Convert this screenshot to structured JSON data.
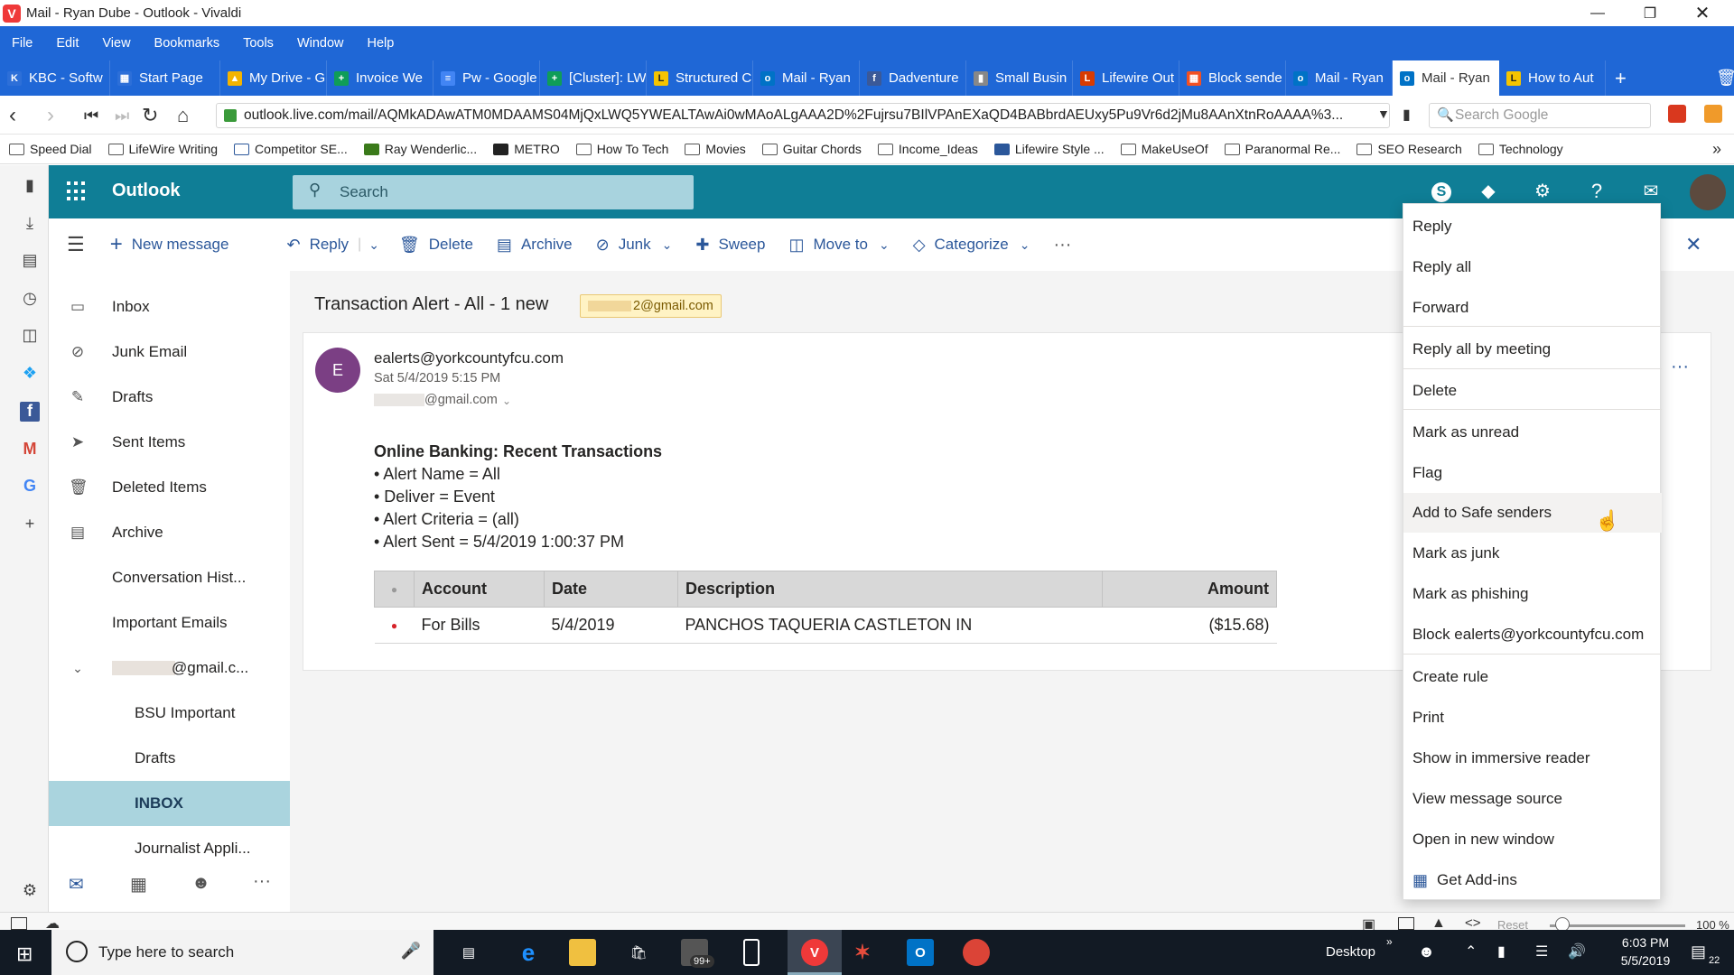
{
  "window": {
    "title": "Mail - Ryan Dube - Outlook - Vivaldi"
  },
  "menubar": [
    "File",
    "Edit",
    "View",
    "Bookmarks",
    "Tools",
    "Window",
    "Help"
  ],
  "tabs": [
    {
      "label": "KBC - Softw",
      "color": "#2d6fd8"
    },
    {
      "label": "Start Page",
      "color": "#2d6fd8"
    },
    {
      "label": "My Drive - G",
      "color": "#f4b400"
    },
    {
      "label": "Invoice We",
      "color": "#0f9d58"
    },
    {
      "label": "Pw - Google",
      "color": "#4285f4"
    },
    {
      "label": "[Cluster]: LW",
      "color": "#0f9d58"
    },
    {
      "label": "Structured C",
      "color": "#f4c400"
    },
    {
      "label": "Mail - Ryan",
      "color": "#0072c6"
    },
    {
      "label": "Dadventure",
      "color": "#3b5998"
    },
    {
      "label": "Small Busin",
      "color": "#888888"
    },
    {
      "label": "Lifewire Out",
      "color": "#d83b01"
    },
    {
      "label": "Block sende",
      "color": "#f25022"
    },
    {
      "label": "Mail - Ryan",
      "color": "#0072c6"
    },
    {
      "label": "Mail - Ryan",
      "color": "#0072c6"
    },
    {
      "label": "How to Aut",
      "color": "#f4c400"
    }
  ],
  "address": {
    "url": "outlook.live.com/mail/AQMkADAwATM0MDAAMS04MjQxLWQ5YWEALTAwAi0wMAoALgAAA2D%2Fujrsu7BIlVPAnEXaQD4BABbrdAEUxy5Pu9Vr6d2jMu8AAnXtnRoAAAA%3...",
    "search_placeholder": "Search Google"
  },
  "bookmarks": [
    "Speed Dial",
    "LifeWire Writing",
    "Competitor SE...",
    "Ray Wenderlic...",
    "METRO",
    "How To Tech",
    "Movies",
    "Guitar Chords",
    "Income_Ideas",
    "Lifewire Style ...",
    "MakeUseOf",
    "Paranormal Re...",
    "SEO Research",
    "Technology"
  ],
  "outlook": {
    "brand": "Outlook",
    "search_placeholder": "Search",
    "skype_letter": "S",
    "help": "?"
  },
  "commands": {
    "new_message": "New message",
    "reply": "Reply",
    "delete": "Delete",
    "archive": "Archive",
    "junk": "Junk",
    "sweep": "Sweep",
    "move_to": "Move to",
    "categorize": "Categorize",
    "more": "···"
  },
  "folders": [
    {
      "label": "Inbox",
      "icon": "inbox-icon"
    },
    {
      "label": "Junk Email",
      "icon": "block-icon"
    },
    {
      "label": "Drafts",
      "icon": "pencil-icon"
    },
    {
      "label": "Sent Items",
      "icon": "send-icon"
    },
    {
      "label": "Deleted Items",
      "icon": "trash-icon"
    },
    {
      "label": "Archive",
      "icon": "archive-icon"
    },
    {
      "label": "Conversation Hist...",
      "icon": ""
    },
    {
      "label": "Important Emails",
      "icon": ""
    },
    {
      "label": "@gmail.c...",
      "icon": "chevron-down-icon"
    },
    {
      "label": "BSU Important",
      "icon": ""
    },
    {
      "label": "Drafts",
      "icon": ""
    },
    {
      "label": "INBOX",
      "icon": ""
    },
    {
      "label": "Journalist Appli...",
      "icon": ""
    }
  ],
  "message": {
    "subject": "Transaction Alert - All - 1 new",
    "recipient_chip": "2@gmail.com",
    "avatar_letter": "E",
    "from": "ealerts@yorkcountyfcu.com",
    "date": "Sat 5/4/2019 5:15 PM",
    "to": "@gmail.com",
    "heading": "Online Banking: Recent Transactions",
    "lines": [
      "• Alert Name = All",
      "• Deliver = Event",
      "• Alert Criteria = (all)",
      "• Alert Sent = 5/4/2019 1:00:37 PM"
    ],
    "table": {
      "headers": [
        "●",
        "Account",
        "Date",
        "Description",
        "Amount"
      ],
      "rows": [
        [
          "●",
          "For Bills",
          "5/4/2019",
          "PANCHOS TAQUERIA CASTLETON IN",
          "($15.68)"
        ]
      ]
    }
  },
  "context_menu": [
    {
      "label": "Reply"
    },
    {
      "label": "Reply all"
    },
    {
      "label": "Forward"
    },
    {
      "label": "Reply all by meeting"
    },
    {
      "label": "Delete"
    },
    {
      "label": "Mark as unread"
    },
    {
      "label": "Flag"
    },
    {
      "label": "Add to Safe senders"
    },
    {
      "label": "Mark as junk"
    },
    {
      "label": "Mark as phishing"
    },
    {
      "label": "Block ealerts@yorkcountyfcu.com"
    },
    {
      "label": "Create rule"
    },
    {
      "label": "Print"
    },
    {
      "label": "Show in immersive reader"
    },
    {
      "label": "View message source"
    },
    {
      "label": "Open in new window"
    },
    {
      "label": "Get Add-ins"
    }
  ],
  "statusbar": {
    "reset": "Reset",
    "zoom": "100 %"
  },
  "taskbar": {
    "search_placeholder": "Type here to search",
    "desktop": "Desktop",
    "time": "6:03 PM",
    "date": "5/5/2019",
    "badge": "99+",
    "notif_count": "22"
  },
  "colors": {
    "accent": "#0f7e96",
    "vivaldi": "#1f67d6",
    "selected_folder": "#aad4de",
    "context_hover": "#f3f2f1"
  }
}
